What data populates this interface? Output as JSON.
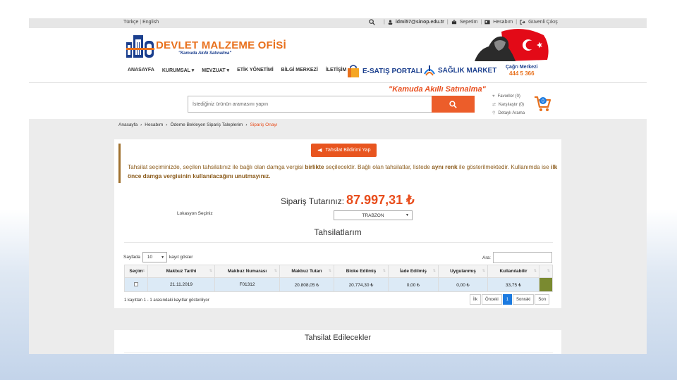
{
  "topbar": {
    "lang_tr": "Türkçe",
    "lang_en": "English",
    "user": "idmi57@sinop.edu.tr",
    "cart": "Sepetim",
    "account": "Hesabım",
    "logout": "Güvenli Çıkış"
  },
  "header": {
    "logo_mark": "DMO",
    "title": "DEVLET MALZEME OFİSİ",
    "slogan": "\"Kamuda Akıllı Satınalma\"",
    "nav": [
      "ANASAYFA",
      "KURUMSAL",
      "MEVZUAT",
      "ETİK YÖNETİMİ",
      "BİLGİ MERKEZİ",
      "İLETİŞİM"
    ],
    "esatis": "E-SATIŞ PORTALI",
    "saglik": "SAĞLIK MARKET",
    "cagri_title": "Çağrı Merkezi",
    "cagri_number": "444 5 366"
  },
  "search": {
    "slogan": "\"Kamuda Akıllı Satınalma\"",
    "placeholder": "İstediğiniz ürünün aramasını yapın",
    "favorites": "Favoriler (0)",
    "compare": "Karşılaştır (0)",
    "advanced": "Detaylı Arama"
  },
  "breadcrumb": [
    "Anasayfa",
    "Hesabım",
    "Ödeme Bekleyen Sipariş Taleplerim",
    "Sipariş Onayı"
  ],
  "notice": {
    "button": "Tahsilat Bildirimi Yap",
    "t1": "Tahsilat seçiminizde, seçilen tahsilatınız ile bağlı olan damga vergisi ",
    "b1": "birlikte",
    "t2": " seçilecektir. Bağlı olan tahsilatlar, listede ",
    "b2": "aynı renk",
    "t3": " ile gösterilmektedir. Kullanımda ise ",
    "b3": "ilk önce damga vergisinin kullanılacağını unutmayınız."
  },
  "order": {
    "total_label": "Sipariş Tutarınız:",
    "total_value": "87.997,31 ₺",
    "location_label": "Lokasyon Seçiniz",
    "location_value": "TRABZON"
  },
  "tahsilat": {
    "title": "Tahsilatlarım",
    "length_prefix": "Sayfada",
    "length_value": "10",
    "length_suffix": "kayıt göster",
    "search_label": "Ara:",
    "columns": [
      "Seçim",
      "Makbuz Tarihi",
      "Makbuz Numarası",
      "Makbuz Tutarı",
      "Bloke Edilmiş",
      "İade Edilmiş",
      "Uygulanmış",
      "Kullanılabilir",
      ""
    ],
    "rows": [
      [
        "",
        "21.11.2019",
        "F01312",
        "20.808,05 ₺",
        "20.774,30 ₺",
        "0,00 ₺",
        "0,00 ₺",
        "33,75 ₺",
        ""
      ]
    ],
    "info": "1 kayıttan 1 - 1 arasındaki kayıtlar gösteriliyor",
    "pager": [
      "İlk",
      "Önceki",
      "1",
      "Sonraki",
      "Son"
    ]
  },
  "edilecek": {
    "title": "Tahsilat Edilecekler"
  },
  "colors": {
    "brand_orange": "#e8701c",
    "brand_blue": "#1b3f8e",
    "linked_green": "#7a8a30"
  }
}
